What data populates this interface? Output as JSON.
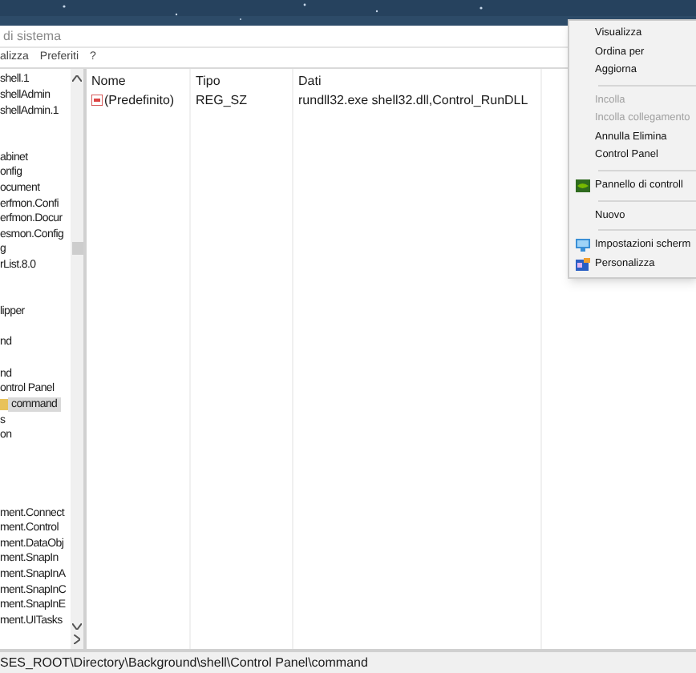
{
  "window": {
    "title": "di sistema"
  },
  "menu_bar": [
    "alizza",
    "Preferiti",
    "?"
  ],
  "tree": {
    "items": [
      {
        "label": "shell.1",
        "selected": false
      },
      {
        "label": "shellAdmin",
        "selected": false
      },
      {
        "label": "shellAdmin.1",
        "selected": false
      },
      {
        "label": "abinet",
        "selected": false
      },
      {
        "label": "onfig",
        "selected": false
      },
      {
        "label": "ocument",
        "selected": false
      },
      {
        "label": "erfmon.Confi",
        "selected": false
      },
      {
        "label": "erfmon.Docur",
        "selected": false
      },
      {
        "label": "esmon.Config",
        "selected": false
      },
      {
        "label": "g",
        "selected": false
      },
      {
        "label": "rList.8.0",
        "selected": false
      },
      {
        "label": "lipper",
        "selected": false
      },
      {
        "label": "nd",
        "selected": false
      },
      {
        "label": "nd",
        "selected": false
      },
      {
        "label": "ontrol Panel",
        "selected": false
      },
      {
        "label": "command",
        "selected": true
      },
      {
        "label": "s",
        "selected": false
      },
      {
        "label": "on",
        "selected": false
      },
      {
        "label": "ment.Connect",
        "selected": false
      },
      {
        "label": "ment.Control",
        "selected": false
      },
      {
        "label": "ment.DataObj",
        "selected": false
      },
      {
        "label": "ment.SnapIn",
        "selected": false
      },
      {
        "label": "ment.SnapInA",
        "selected": false
      },
      {
        "label": "ment.SnapInC",
        "selected": false
      },
      {
        "label": "ment.SnapInE",
        "selected": false
      },
      {
        "label": "ment.UITasks",
        "selected": false
      }
    ]
  },
  "table": {
    "columns": [
      "Nome",
      "Tipo",
      "Dati"
    ],
    "rows": [
      {
        "name": "(Predefinito)",
        "type": "REG_SZ",
        "data": "rundll32.exe shell32.dll,Control_RunDLL"
      }
    ]
  },
  "status_bar": "SES_ROOT\\Directory\\Background\\shell\\Control Panel\\command",
  "context_menu": [
    {
      "kind": "item",
      "label": "Visualizza",
      "disabled": false
    },
    {
      "kind": "item",
      "label": "Ordina per",
      "disabled": false
    },
    {
      "kind": "item",
      "label": "Aggiorna",
      "disabled": false
    },
    {
      "kind": "separator"
    },
    {
      "kind": "item",
      "label": "Incolla",
      "disabled": true
    },
    {
      "kind": "item",
      "label": "Incolla collegamento",
      "disabled": true
    },
    {
      "kind": "item",
      "label": "Annulla Elimina",
      "disabled": false
    },
    {
      "kind": "item",
      "label": "Control Panel",
      "disabled": false
    },
    {
      "kind": "separator"
    },
    {
      "kind": "app_item",
      "label": "Pannello di controll",
      "disabled": false
    },
    {
      "kind": "separator"
    },
    {
      "kind": "item",
      "label": "Nuovo",
      "disabled": false
    },
    {
      "kind": "separator"
    },
    {
      "kind": "display_item",
      "label": "Impostazioni scherm",
      "disabled": false
    },
    {
      "kind": "personalize_item",
      "label": "Personalizza",
      "disabled": false
    }
  ]
}
